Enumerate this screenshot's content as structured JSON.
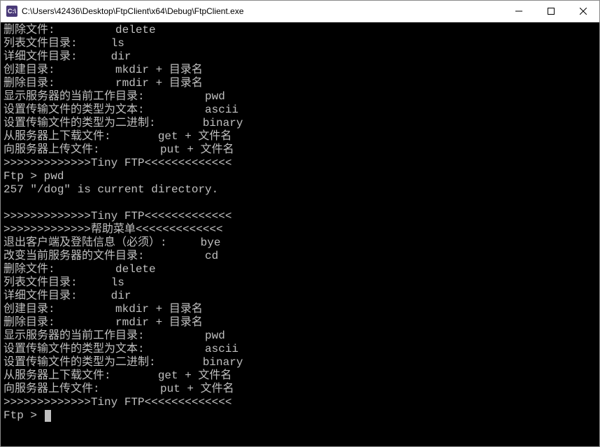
{
  "titlebar": {
    "icon_text": "C:\\",
    "title": "C:\\Users\\42436\\Desktop\\FtpClient\\x64\\Debug\\FtpClient.exe"
  },
  "console": {
    "lines": [
      "删除文件:         delete",
      "列表文件目录:     ls",
      "详细文件目录:     dir",
      "创建目录:         mkdir + 目录名",
      "删除目录:         rmdir + 目录名",
      "显示服务器的当前工作目录:         pwd",
      "设置传输文件的类型为文本:         ascii",
      "设置传输文件的类型为二进制:       binary",
      "从服务器上下载文件:       get + 文件名",
      "向服务器上传文件:         put + 文件名",
      ">>>>>>>>>>>>>Tiny FTP<<<<<<<<<<<<<",
      "Ftp > pwd",
      "257 \"/dog\" is current directory.",
      "",
      ">>>>>>>>>>>>>Tiny FTP<<<<<<<<<<<<<",
      ">>>>>>>>>>>>>帮助菜单<<<<<<<<<<<<<",
      "退出客户端及登陆信息（必须）:     bye",
      "改变当前服务器的文件目录:         cd",
      "删除文件:         delete",
      "列表文件目录:     ls",
      "详细文件目录:     dir",
      "创建目录:         mkdir + 目录名",
      "删除目录:         rmdir + 目录名",
      "显示服务器的当前工作目录:         pwd",
      "设置传输文件的类型为文本:         ascii",
      "设置传输文件的类型为二进制:       binary",
      "从服务器上下载文件:       get + 文件名",
      "向服务器上传文件:         put + 文件名",
      ">>>>>>>>>>>>>Tiny FTP<<<<<<<<<<<<<"
    ],
    "prompt": "Ftp > "
  }
}
